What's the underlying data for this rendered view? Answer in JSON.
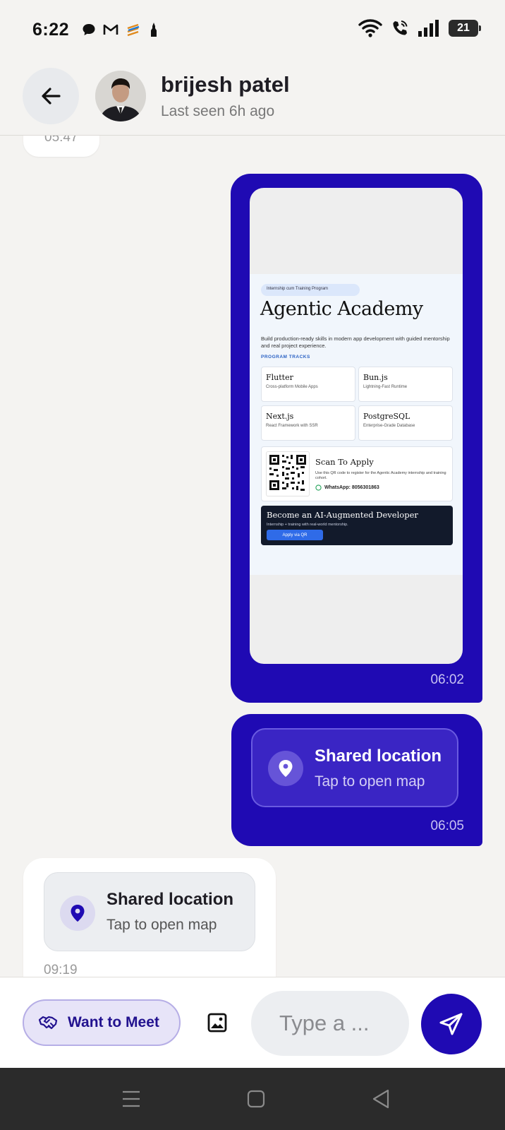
{
  "status_bar": {
    "time": "6:22",
    "battery": "21"
  },
  "header": {
    "name": "brijesh patel",
    "status": "Last seen 6h ago"
  },
  "messages": {
    "top_partial_time": "05:47",
    "image_message": {
      "time": "06:02",
      "poster": {
        "tag": "Internship cum Training Program",
        "title": "Agentic Academy",
        "description": "Build production-ready skills in modern app development with guided mentorship and real project experience.",
        "tracks_label": "PROGRAM TRACKS",
        "tracks": [
          {
            "name": "Flutter",
            "sub": "Cross-platform Mobile Apps"
          },
          {
            "name": "Bun.js",
            "sub": "Lightning-Fast Runtime"
          },
          {
            "name": "Next.js",
            "sub": "React Framework with SSR"
          },
          {
            "name": "PostgreSQL",
            "sub": "Enterprise-Grade Database"
          }
        ],
        "scan_title": "Scan To Apply",
        "scan_desc": "Use this QR code to register for the Agentic Academy internship and training cohort.",
        "whatsapp": "WhatsApp: 8056301863",
        "cta_title": "Become an AI-Augmented Developer",
        "cta_sub": "Internship + training with real-world mentorship.",
        "cta_button": "Apply via QR"
      }
    },
    "location_out": {
      "title": "Shared location",
      "subtitle": "Tap to open map",
      "time": "06:05"
    },
    "location_in": {
      "title": "Shared location",
      "subtitle": "Tap to open map",
      "time": "09:19"
    }
  },
  "input_bar": {
    "meet_label": "Want to Meet",
    "placeholder": "Type a ..."
  },
  "colors": {
    "accent": "#1f0ab3",
    "background": "#f4f3f1",
    "meet_bg": "#e7e4f8"
  },
  "icons": [
    "back-arrow-icon",
    "map-pin-icon",
    "handshake-icon",
    "image-icon",
    "send-icon",
    "wifi-icon",
    "call-icon",
    "signal-icon",
    "battery-icon",
    "menu-nav-icon",
    "home-nav-icon",
    "back-nav-icon"
  ]
}
